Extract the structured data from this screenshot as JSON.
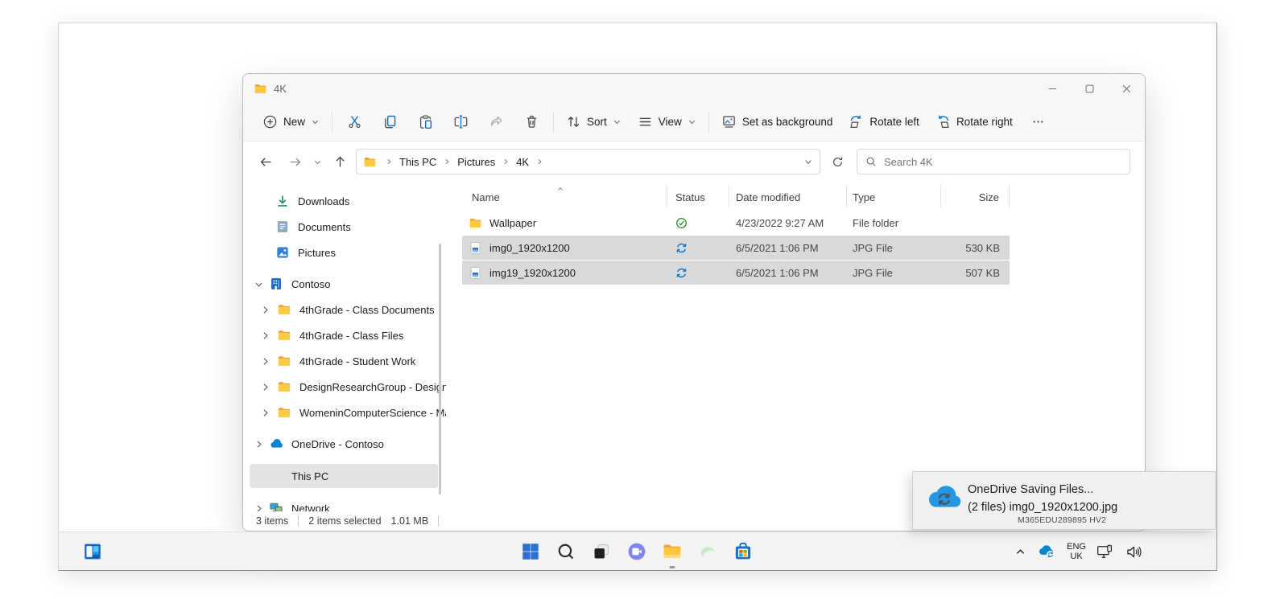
{
  "window": {
    "title": "4K",
    "toolbar": {
      "new": "New",
      "sort": "Sort",
      "view": "View",
      "set_as_background": "Set as background",
      "rotate_left": "Rotate left",
      "rotate_right": "Rotate right"
    },
    "address": {
      "crumbs": [
        "This PC",
        "Pictures",
        "4K"
      ],
      "search_placeholder": "Search 4K"
    },
    "sidebar": {
      "items": [
        {
          "label": "Downloads"
        },
        {
          "label": "Documents"
        },
        {
          "label": "Pictures"
        },
        {
          "label": "Contoso"
        },
        {
          "label": "4thGrade - Class Documents"
        },
        {
          "label": "4thGrade - Class Files"
        },
        {
          "label": "4thGrade - Student Work"
        },
        {
          "label": "DesignResearchGroup - Design Re"
        },
        {
          "label": "WomeninComputerScience - Man"
        },
        {
          "label": "OneDrive - Contoso"
        },
        {
          "label": "This PC"
        },
        {
          "label": "Network"
        }
      ]
    },
    "filelist": {
      "columns": [
        "Name",
        "Status",
        "Date modified",
        "Type",
        "Size"
      ],
      "rows": [
        {
          "name": "Wallpaper",
          "date": "4/23/2022 9:27 AM",
          "type": "File folder",
          "size": ""
        },
        {
          "name": "img0_1920x1200",
          "date": "6/5/2021 1:06 PM",
          "type": "JPG File",
          "size": "530 KB"
        },
        {
          "name": "img19_1920x1200",
          "date": "6/5/2021 1:06 PM",
          "type": "JPG File",
          "size": "507 KB"
        }
      ]
    },
    "statusbar": {
      "count": "3 items",
      "selected": "2 items selected",
      "size": "1.01 MB"
    }
  },
  "toast": {
    "title": "OneDrive Saving Files...",
    "detail": "(2 files) img0_1920x1200.jpg",
    "watermark": "M365EDU289895 HV2"
  },
  "taskbar": {
    "lang_line1": "ENG",
    "lang_line2": "UK"
  },
  "colors": {
    "accent": "#0f6cbd",
    "selection": "#d9d9d9",
    "sync_blue": "#0078d4",
    "check_green": "#107c10",
    "folder_yellow": "#ffc940",
    "taskbar_bg": "#f3f3f3"
  }
}
